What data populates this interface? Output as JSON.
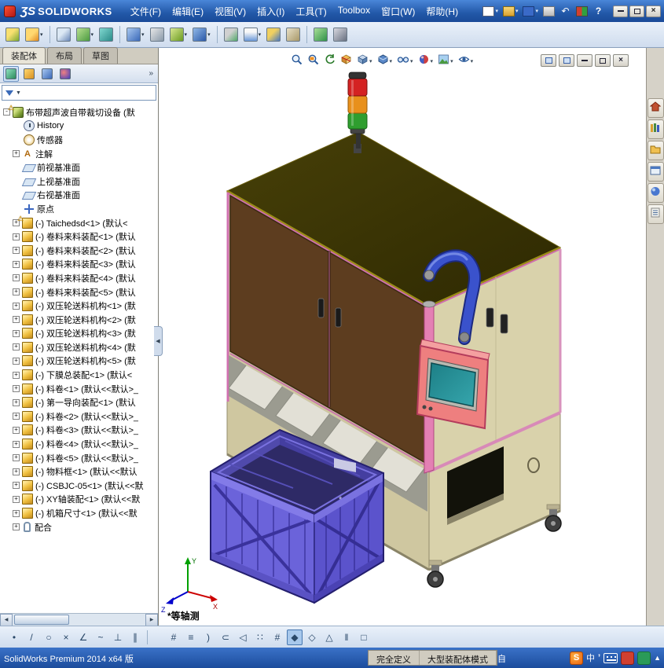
{
  "titlebar": {
    "logo_mark": "ƷS",
    "brand": "SOLIDWORKS",
    "menus": [
      "文件(F)",
      "编辑(E)",
      "视图(V)",
      "插入(I)",
      "工具(T)",
      "Toolbox",
      "窗口(W)",
      "帮助(H)"
    ],
    "quick_icons": [
      {
        "name": "new-document",
        "caret": true
      },
      {
        "name": "open-document",
        "caret": true
      },
      {
        "name": "save-document",
        "caret": true
      },
      {
        "name": "print",
        "caret": false
      },
      {
        "name": "undo",
        "caret": false
      },
      {
        "name": "options",
        "caret": false
      },
      {
        "name": "help",
        "caret": false
      }
    ],
    "window_buttons": [
      "minimize",
      "maximize",
      "close"
    ]
  },
  "toolbar": {
    "icons": [
      {
        "name": "edit-component",
        "palette": "p1",
        "caret": false,
        "sep_after": false
      },
      {
        "name": "insert-component",
        "palette": "p2",
        "caret": true,
        "sep_after": true
      },
      {
        "name": "mate",
        "palette": "p3",
        "caret": false,
        "sep_after": false
      },
      {
        "name": "linear-component-pattern",
        "palette": "p4",
        "caret": true,
        "sep_after": false
      },
      {
        "name": "smart-fasteners",
        "palette": "p5",
        "caret": false,
        "sep_after": true
      },
      {
        "name": "move-component",
        "palette": "p6",
        "caret": true,
        "sep_after": false
      },
      {
        "name": "show-hidden-components",
        "palette": "p7",
        "caret": false,
        "sep_after": false
      },
      {
        "name": "assembly-features",
        "palette": "p8",
        "caret": true,
        "sep_after": false
      },
      {
        "name": "reference-geometry",
        "palette": "p9",
        "caret": true,
        "sep_after": true
      },
      {
        "name": "new-motion-study",
        "palette": "p10",
        "caret": false,
        "sep_after": false
      },
      {
        "name": "bill-of-materials",
        "palette": "p11",
        "caret": true,
        "sep_after": false
      },
      {
        "name": "exploded-view",
        "palette": "p12",
        "caret": false,
        "sep_after": false
      },
      {
        "name": "instant3d",
        "palette": "p13",
        "caret": false,
        "sep_after": true
      },
      {
        "name": "update-speedpak",
        "palette": "p14",
        "caret": false,
        "sep_after": false
      },
      {
        "name": "take-snapshot",
        "palette": "p15",
        "caret": false,
        "sep_after": false
      }
    ]
  },
  "left_panel": {
    "tabs": [
      {
        "label": "装配体",
        "active": true
      },
      {
        "label": "布局",
        "active": false
      },
      {
        "label": "草图",
        "active": false
      }
    ],
    "manager_icons": [
      "featuremanager",
      "propertymanager",
      "configurationmanager",
      "dimxpertmanager"
    ],
    "more_label": "»",
    "tree": {
      "items": [
        {
          "icon": "assembly-root",
          "expander": "minus",
          "warning": true,
          "label": "布带超声波自带裁切设备 (默"
        },
        {
          "icon": "history",
          "expander": null,
          "warning": false,
          "label": "History"
        },
        {
          "icon": "sensors",
          "expander": null,
          "warning": false,
          "label": "传感器"
        },
        {
          "icon": "annotations",
          "expander": "plus",
          "warning": false,
          "label": "注解"
        },
        {
          "icon": "plane",
          "expander": null,
          "warning": false,
          "label": "前视基准面"
        },
        {
          "icon": "plane",
          "expander": null,
          "warning": false,
          "label": "上视基准面"
        },
        {
          "icon": "plane",
          "expander": null,
          "warning": false,
          "label": "右视基准面"
        },
        {
          "icon": "origin",
          "expander": null,
          "warning": false,
          "label": "原点"
        },
        {
          "icon": "component",
          "expander": "plus",
          "warning": true,
          "label": "(-) Taichedsd<1> (默认<"
        },
        {
          "icon": "component",
          "expander": "plus",
          "warning": false,
          "label": "(-) 卷料来料装配<1> (默认"
        },
        {
          "icon": "component",
          "expander": "plus",
          "warning": false,
          "label": "(-) 卷料来料装配<2> (默认"
        },
        {
          "icon": "component",
          "expander": "plus",
          "warning": false,
          "label": "(-) 卷料来料装配<3> (默认"
        },
        {
          "icon": "component",
          "expander": "plus",
          "warning": false,
          "label": "(-) 卷料来料装配<4> (默认"
        },
        {
          "icon": "component",
          "expander": "plus",
          "warning": false,
          "label": "(-) 卷料来料装配<5> (默认"
        },
        {
          "icon": "component",
          "expander": "plus",
          "warning": false,
          "label": "(-) 双压轮送料机构<1> (默"
        },
        {
          "icon": "component",
          "expander": "plus",
          "warning": false,
          "label": "(-) 双压轮送料机构<2> (默"
        },
        {
          "icon": "component",
          "expander": "plus",
          "warning": false,
          "label": "(-) 双压轮送料机构<3> (默"
        },
        {
          "icon": "component",
          "expander": "plus",
          "warning": false,
          "label": "(-) 双压轮送料机构<4> (默"
        },
        {
          "icon": "component",
          "expander": "plus",
          "warning": false,
          "label": "(-) 双压轮送料机构<5> (默"
        },
        {
          "icon": "component",
          "expander": "plus",
          "warning": false,
          "label": "(-) 下膜总装配<1> (默认<"
        },
        {
          "icon": "component",
          "expander": "plus",
          "warning": false,
          "label": "(-) 料卷<1> (默认<<默认>_"
        },
        {
          "icon": "component",
          "expander": "plus",
          "warning": false,
          "label": "(-) 第一导向装配<1> (默认"
        },
        {
          "icon": "component",
          "expander": "plus",
          "warning": false,
          "label": "(-) 料卷<2> (默认<<默认>_"
        },
        {
          "icon": "component",
          "expander": "plus",
          "warning": false,
          "label": "(-) 料卷<3> (默认<<默认>_"
        },
        {
          "icon": "component",
          "expander": "plus",
          "warning": false,
          "label": "(-) 料卷<4> (默认<<默认>_"
        },
        {
          "icon": "component",
          "expander": "plus",
          "warning": false,
          "label": "(-) 料卷<5> (默认<<默认>_"
        },
        {
          "icon": "component",
          "expander": "plus",
          "warning": false,
          "label": "(-) 物料框<1> (默认<<默认"
        },
        {
          "icon": "component",
          "expander": "plus",
          "warning": false,
          "label": "(-) CSBJC-05<1> (默认<<默"
        },
        {
          "icon": "component",
          "expander": "plus",
          "warning": false,
          "label": "(-) XY轴装配<1> (默认<<默"
        },
        {
          "icon": "component",
          "expander": "plus",
          "warning": false,
          "label": "(-) 机箱尺寸<1> (默认<<默"
        },
        {
          "icon": "mates",
          "expander": "plus",
          "warning": false,
          "label": "配合"
        }
      ]
    }
  },
  "viewport": {
    "hud": [
      "zoom-fit",
      "zoom-area",
      "previous-view",
      "section-view",
      "view-orientation",
      "display-style",
      "hide-show-items",
      "edit-appearance",
      "apply-scene",
      "view-settings"
    ],
    "view_label": "*等轴测",
    "triad": {
      "x": "X",
      "y": "Y",
      "z": "Z"
    }
  },
  "task_pane": {
    "icons": [
      "solidworks-resources",
      "design-library",
      "file-explorer",
      "view-palette",
      "appearances-scenes",
      "custom-properties"
    ]
  },
  "bottom_toolbar": {
    "group1": [
      "sketch-point",
      "sketch-line",
      "sketch-circle",
      "sketch-erase",
      "sketch-angle",
      "sketch-spline",
      "sketch-perpendicular",
      "sketch-parallel"
    ],
    "group2": [
      {
        "name": "trim-entities",
        "active": false
      },
      {
        "name": "extend-entities",
        "active": false
      },
      {
        "name": "offset-entities",
        "active": false
      },
      {
        "name": "convert-entities",
        "active": false
      },
      {
        "name": "mirror-entities",
        "active": false
      },
      {
        "name": "sketch-pattern",
        "active": false
      },
      {
        "name": "display-grid",
        "active": false
      },
      {
        "name": "shaded-with-edges",
        "active": true
      },
      {
        "name": "wireframe",
        "active": false
      },
      {
        "name": "section-display",
        "active": false
      },
      {
        "name": "split-pane",
        "active": false
      },
      {
        "name": "close-pane",
        "active": false
      }
    ]
  },
  "statusbar": {
    "product": "SolidWorks Premium 2014 x64 版",
    "definition_status": "完全定义",
    "assembly_mode": "大型装配体模式",
    "extra": "自",
    "ime": {
      "sogou": "S",
      "lang": "中"
    }
  }
}
